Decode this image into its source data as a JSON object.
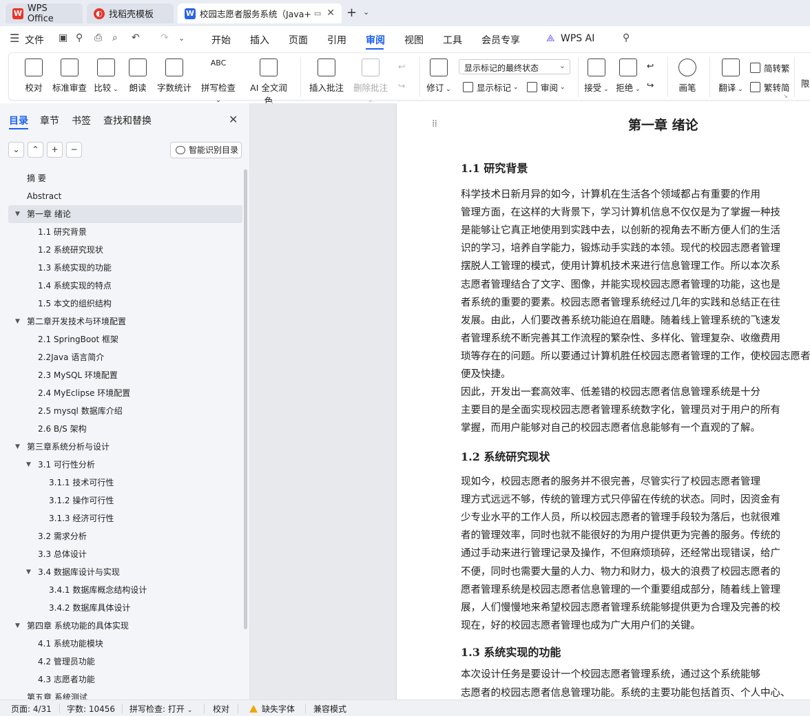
{
  "tabs": [
    {
      "label": "WPS Office",
      "icon": "wps-logo-icon"
    },
    {
      "label": "找稻壳模板",
      "icon": "docer-logo-icon"
    },
    {
      "label": "校园志愿者服务系统（Java+",
      "icon": "writer-logo-icon"
    }
  ],
  "menu": {
    "file": "文件",
    "items": [
      "开始",
      "插入",
      "页面",
      "引用",
      "审阅",
      "视图",
      "工具",
      "会员专享"
    ],
    "ai": "WPS AI",
    "active": "审阅"
  },
  "ribbon": {
    "proofread": "校对",
    "standard_review": "标准审查",
    "compare": "比较",
    "read_aloud": "朗读",
    "word_count": "字数统计",
    "spell_check": "拼写检查",
    "ai_polish": "AI 全文润色",
    "insert_comment": "插入批注",
    "delete_comment": "删除批注",
    "track": "修订",
    "display_select": "显示标记的最终状态",
    "show_markup": "显示标记",
    "review_pane": "审阅",
    "accept": "接受",
    "reject": "拒绝",
    "pen": "画笔",
    "translate": "翻译",
    "to_traditional": "简转繁",
    "to_simplified": "繁转简",
    "restrict": "限"
  },
  "panel": {
    "tabs": [
      "目录",
      "章节",
      "书签",
      "查找和替换"
    ],
    "smart_btn": "智能识别目录",
    "toc": [
      {
        "label": "摘  要",
        "level": 0
      },
      {
        "label": "Abstract",
        "level": 0
      },
      {
        "label": "第一章  绪论",
        "level": 0,
        "expand": true,
        "selected": true
      },
      {
        "label": "1.1    研究背景",
        "level": 1
      },
      {
        "label": "1.2    系统研究现状",
        "level": 1
      },
      {
        "label": "1.3    系统实现的功能",
        "level": 1
      },
      {
        "label": "1.4 系统实现的特点",
        "level": 1
      },
      {
        "label": "1.5    本文的组织结构",
        "level": 1
      },
      {
        "label": "第二章开发技术与环境配置",
        "level": 0,
        "expand": true
      },
      {
        "label": "2.1    SpringBoot 框架",
        "level": 1
      },
      {
        "label": " 2.2Java 语言简介",
        "level": 1
      },
      {
        "label": "2.3    MySQL 环境配置",
        "level": 1
      },
      {
        "label": "2.4    MyEclipse 环境配置",
        "level": 1
      },
      {
        "label": "2.5    mysql 数据库介绍",
        "level": 1
      },
      {
        "label": "2.6    B/S 架构",
        "level": 1
      },
      {
        "label": "第三章系统分析与设计",
        "level": 0,
        "expand": true
      },
      {
        "label": "3.1  可行性分析",
        "level": 1,
        "expand": true
      },
      {
        "label": "3.1.1  技术可行性",
        "level": 2
      },
      {
        "label": "3.1.2  操作可行性",
        "level": 2
      },
      {
        "label": "3.1.3 经济可行性",
        "level": 2
      },
      {
        "label": "3.2    需求分析",
        "level": 1
      },
      {
        "label": "3.3    总体设计",
        "level": 1
      },
      {
        "label": "3.4    数据库设计与实现",
        "level": 1,
        "expand": true
      },
      {
        "label": "3.4.1    数据库概念结构设计",
        "level": 2
      },
      {
        "label": "3.4.2 数据库具体设计",
        "level": 2
      },
      {
        "label": "第四章    系统功能的具体实现",
        "level": 0,
        "expand": true
      },
      {
        "label": "4.1  系统功能模块",
        "level": 1
      },
      {
        "label": "4.2 管理员功能",
        "level": 1
      },
      {
        "label": "4.3 志愿者功能",
        "level": 1
      },
      {
        "label": "第五章  系统测试",
        "level": 0
      }
    ]
  },
  "doc": {
    "chapter": "第一章  绪论",
    "s1": "1.1    研究背景",
    "p1": [
      "      科学技术日新月异的如今，计算机在生活各个领域都占有重要的作用",
      "管理方面，在这样的大背景下，学习计算机信息不仅仅是为了掌握一种技",
      "是能够让它真正地使用到实践中去，以创新的视角去不断方便人们的生活",
      "识的学习，培养自学能力，锻炼动手实践的本领。现代的校园志愿者管理",
      "摆脱人工管理的模式，使用计算机技术来进行信息管理工作。所以本次系",
      "志愿者管理结合了文字、图像，并能实现校园志愿者管理的功能，这也是",
      "者系统的重要的要素。校园志愿者管理系统经过几年的实践和总结正在往",
      "发展。由此，人们要改善系统功能迫在眉睫。随着线上管理系统的飞速发",
      "者管理系统不断完善其工作流程的繁杂性、多样化、管理复杂、收缴费用",
      "琐等存在的问题。所以要通过计算机胜任校园志愿者管理的工作，使校园志愿者系统",
      "便及快捷。",
      "      因此，开发出一套高效率、低差错的校园志愿者信息管理系统是十分",
      "主要目的是全面实现校园志愿者管理系统数字化，管理员对于用户的所有",
      "掌握，而用户能够对自己的校园志愿者信息能够有一个直观的了解。"
    ],
    "s2": "1.2    系统研究现状",
    "p2": [
      "      现如今，校园志愿者的服务并不很完善，尽管实行了校园志愿者管理",
      "理方式远远不够，传统的管理方式只停留在传统的状态。同时，因资金有",
      "少专业水平的工作人员，所以校园志愿者的管理手段较为落后，也就很难",
      "者的管理效率，同时也就不能很好的为用户提供更为完善的服务。传统的",
      "通过手动来进行管理记录及操作，不但麻烦琐碎，还经常出现错误，给广",
      "不便，同时也需要大量的人力、物力和财力，极大的浪费了校园志愿者的",
      "愿者管理系统是校园志愿者信息管理的一个重要组成部分，随着线上管理",
      "展，人们慢慢地来希望校园志愿者管理系统能够提供更为合理及完善的校",
      "现在，好的校园志愿者管理也成为广大用户们的关键。"
    ],
    "s3": "1.3    系统实现的功能",
    "p3": [
      "      本次设计任务是要设计一个校园志愿者管理系统，通过这个系统能够",
      "志愿者的校园志愿者信息管理功能。系统的主要功能包括首页、个人中心、"
    ]
  },
  "status": {
    "page": "页面: 4/31",
    "words": "字数: 10456",
    "spell": "拼写检查: 打开",
    "proof": "校对",
    "missing_font": "缺失字体",
    "compat": "兼容模式"
  }
}
